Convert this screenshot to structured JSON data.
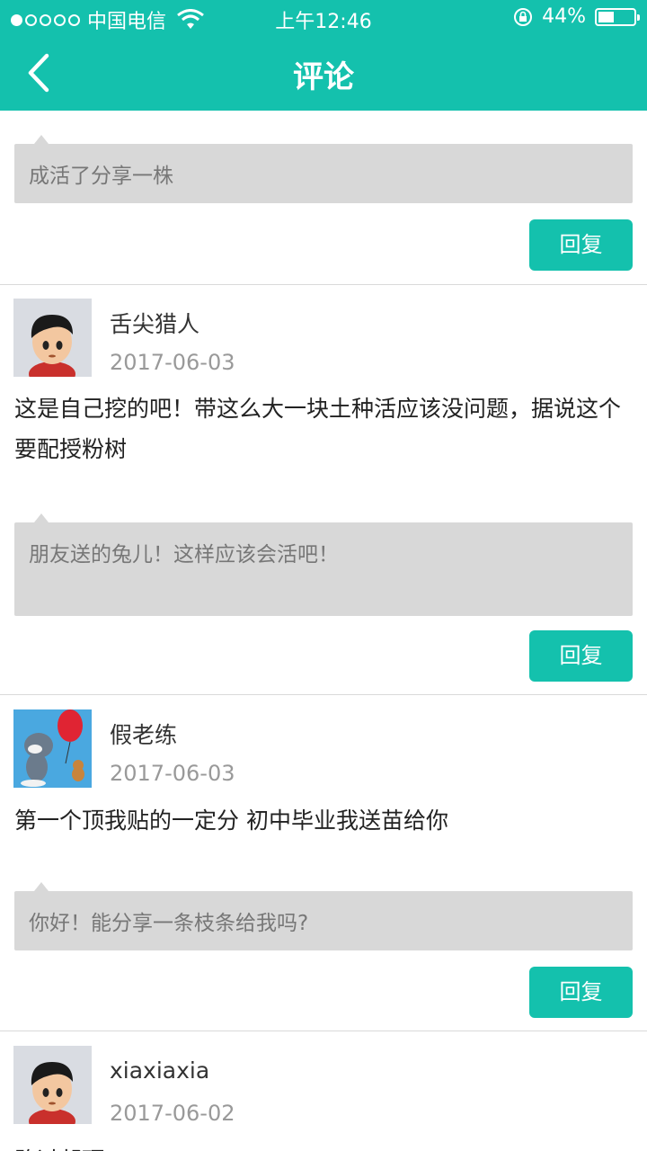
{
  "status_bar": {
    "carrier": "中国电信",
    "time": "上午12:46",
    "battery": "44%",
    "battery_level": 0.44
  },
  "nav": {
    "title": "评论"
  },
  "top_reply": {
    "text": "成活了分享一株",
    "button": "回复"
  },
  "comments": [
    {
      "username": "舌尖猎人",
      "date": "2017-06-03",
      "text": "这是自己挖的吧！带这么大一块土种活应该没问题，据说这个要配授粉树",
      "reply": "朋友送的兔儿！这样应该会活吧！",
      "button": "回复",
      "avatar": "cartoon-boy-avatar"
    },
    {
      "username": "假老练",
      "date": "2017-06-03",
      "text": "第一个顶我贴的一定分 初中毕业我送苗给你",
      "reply": "你好！能分享一条枝条给我吗?",
      "button": "回复",
      "avatar": "tom-and-jerry-avatar"
    },
    {
      "username": "xiaxiaxia",
      "date": "2017-06-02",
      "text": "路过帮顶",
      "avatar": "cartoon-boy-avatar"
    }
  ],
  "colors": {
    "accent": "#14c1ad",
    "reply_bg": "#d8d8d8"
  }
}
